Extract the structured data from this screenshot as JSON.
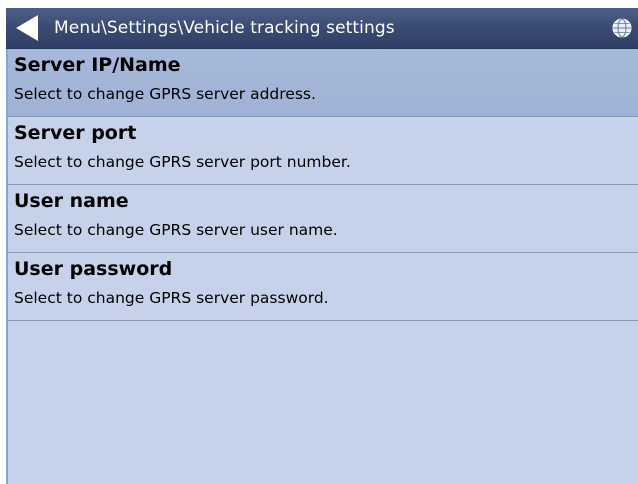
{
  "header": {
    "title": "Menu\\Settings\\Vehicle tracking settings"
  },
  "items": [
    {
      "label": "Server IP/Name",
      "description": "Select to change GPRS server address."
    },
    {
      "label": "Server port",
      "description": "Select to change GPRS server port number."
    },
    {
      "label": "User name",
      "description": "Select to change GPRS server user name."
    },
    {
      "label": "User password",
      "description": "Select to change GPRS server password."
    }
  ],
  "icons": {
    "back": "back-arrow-icon",
    "globe": "globe-icon"
  },
  "colors": {
    "titlebar": "#3a4b73",
    "list_background": "#c5d2ea",
    "selected_item": "#a3b6d8",
    "divider": "#8a97b4"
  }
}
